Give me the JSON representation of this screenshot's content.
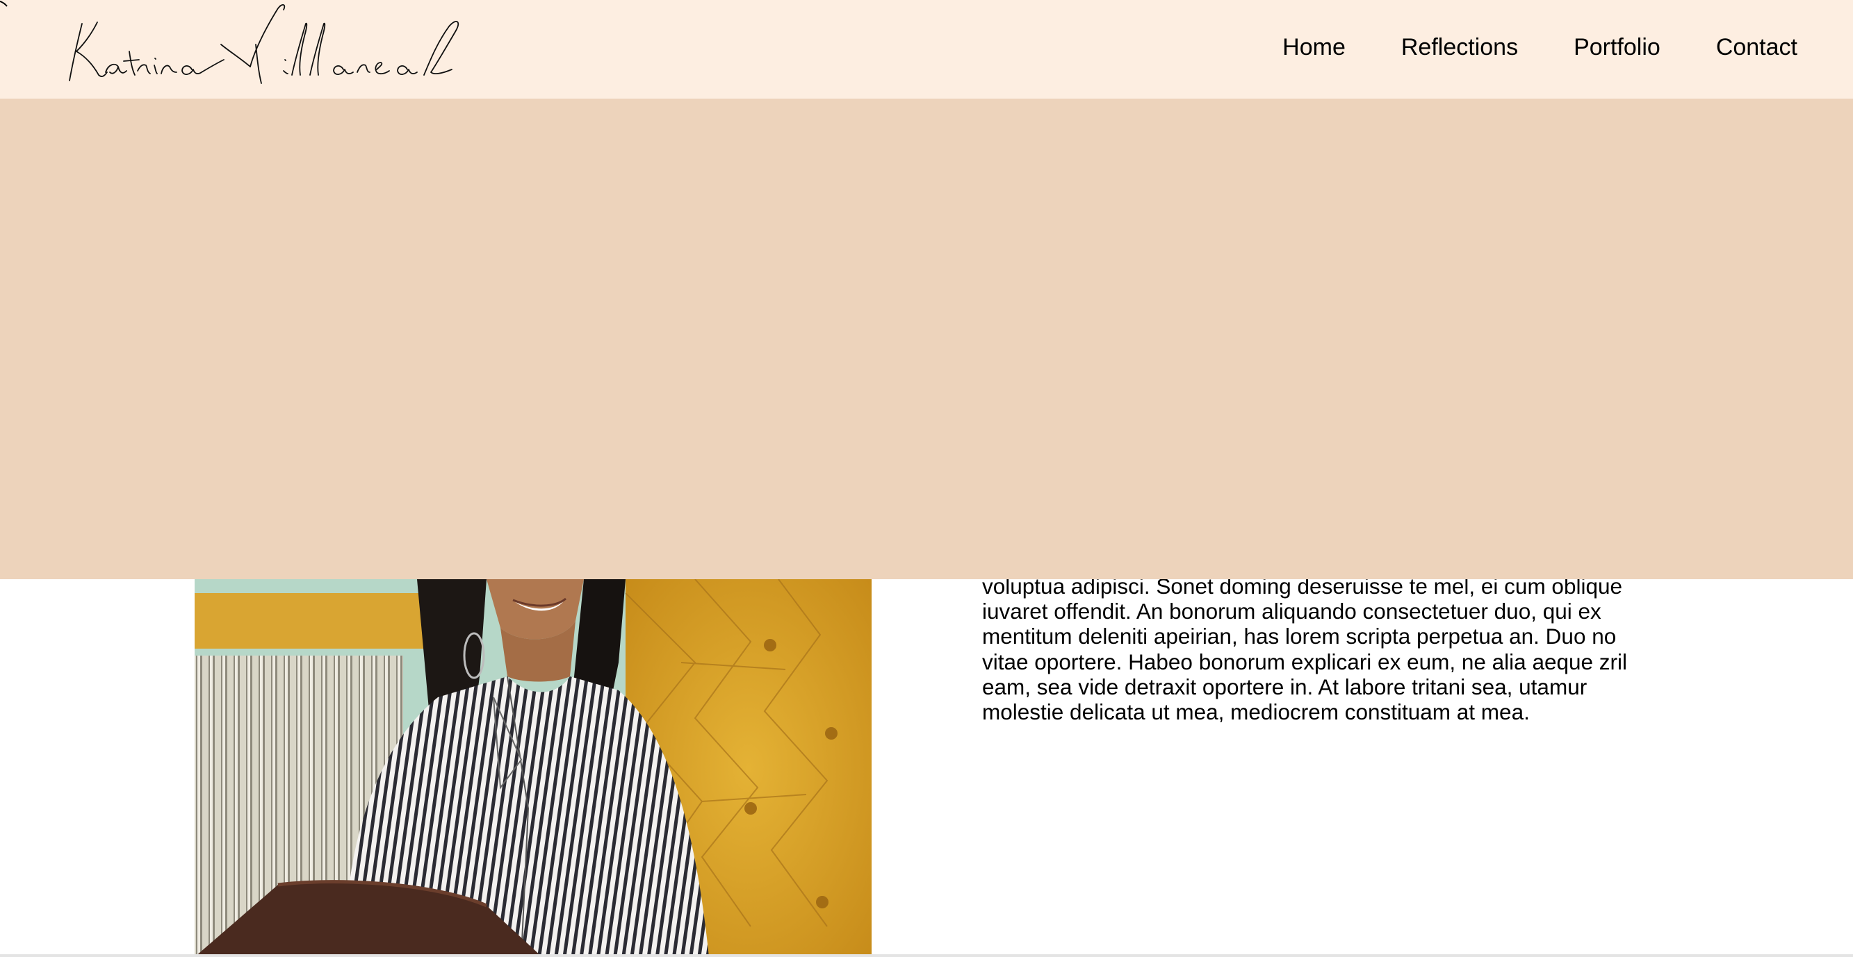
{
  "header": {
    "logo_text": "Katrina Villareal",
    "nav": [
      {
        "label": "Home"
      },
      {
        "label": "Reflections"
      },
      {
        "label": "Portfolio"
      },
      {
        "label": "Contact"
      }
    ]
  },
  "about": {
    "paragraph": "voluptua adipisci. Sonet doming deseruisse te mel, ei cum oblique iuvaret offendit. An bonorum aliquando consectetuer duo, qui ex mentitum deleniti apeirian, has lorem scripta perpetua an. Duo no vitae oportere. Habeo bonorum explicari ex eum, ne alia aeque zril eam, sea vide detraxit oportere in. At labore tritani sea, utamur molestie delicata ut mea, mediocrem constituam at mea."
  },
  "colors": {
    "header_bg": "#fdeee1",
    "hero_bg": "#edd3bb",
    "page_bg": "#ffffff",
    "text": "#000000"
  }
}
